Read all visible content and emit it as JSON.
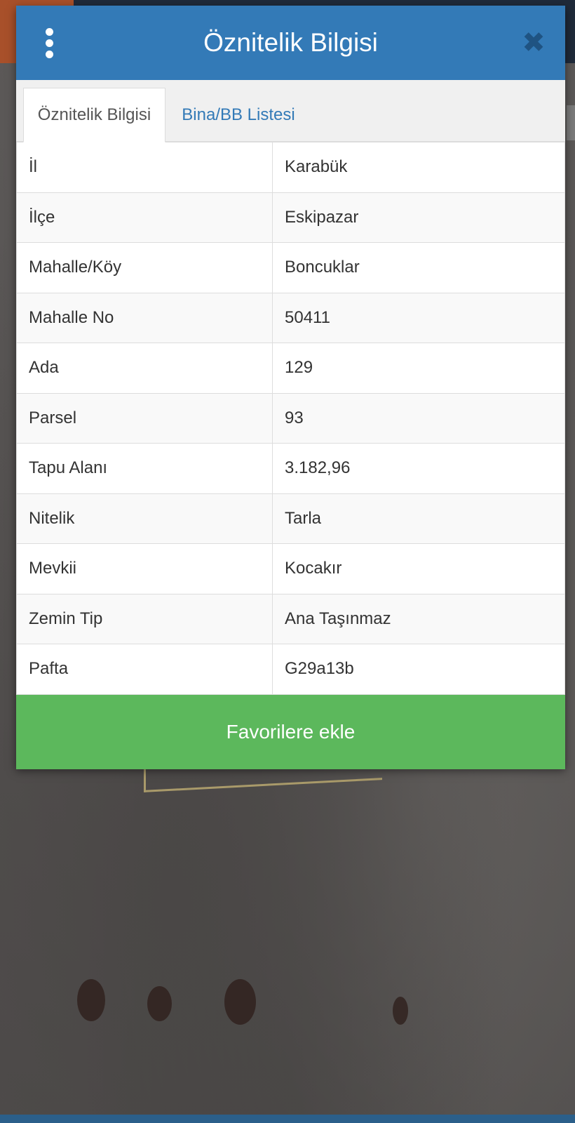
{
  "dialog": {
    "title": "Öznitelik Bilgisi",
    "close_symbol": "✖",
    "menu_icon": "kebab-menu-icon"
  },
  "tabs": [
    {
      "label": "Öznitelik Bilgisi",
      "active": true
    },
    {
      "label": "Bina/BB Listesi",
      "active": false
    }
  ],
  "attributes": [
    {
      "key": "İl",
      "value": "Karabük"
    },
    {
      "key": "İlçe",
      "value": "Eskipazar"
    },
    {
      "key": "Mahalle/Köy",
      "value": "Boncuklar"
    },
    {
      "key": "Mahalle No",
      "value": "50411"
    },
    {
      "key": "Ada",
      "value": "129"
    },
    {
      "key": "Parsel",
      "value": "93"
    },
    {
      "key": "Tapu Alanı",
      "value": "3.182,96"
    },
    {
      "key": "Nitelik",
      "value": "Tarla"
    },
    {
      "key": "Mevkii",
      "value": "Kocakır"
    },
    {
      "key": "Zemin Tip",
      "value": "Ana Taşınmaz"
    },
    {
      "key": "Pafta",
      "value": "G29a13b"
    }
  ],
  "favorite_button": {
    "label": "Favorilere ekle"
  },
  "colors": {
    "header": "#337ab7",
    "favorite": "#5cb85c",
    "tab_link": "#337ab7"
  }
}
